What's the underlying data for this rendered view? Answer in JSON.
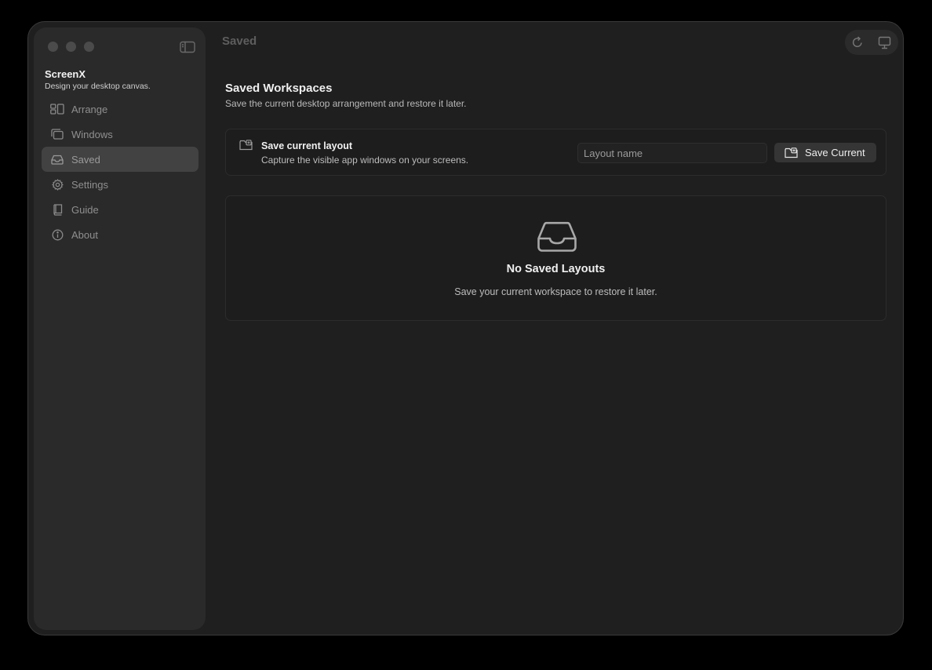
{
  "app": {
    "name": "ScreenX",
    "tagline": "Design your desktop canvas."
  },
  "sidebar": {
    "items": [
      {
        "label": "Arrange",
        "icon": "arrange-icon",
        "active": false
      },
      {
        "label": "Windows",
        "icon": "windows-icon",
        "active": false
      },
      {
        "label": "Saved",
        "icon": "saved-tray-icon",
        "active": true
      },
      {
        "label": "Settings",
        "icon": "gear-icon",
        "active": false
      },
      {
        "label": "Guide",
        "icon": "book-icon",
        "active": false
      },
      {
        "label": "About",
        "icon": "info-icon",
        "active": false
      }
    ]
  },
  "header": {
    "title": "Saved",
    "toolbar": [
      "refresh-icon",
      "display-icon"
    ]
  },
  "main": {
    "section_title": "Saved Workspaces",
    "section_subtitle": "Save the current desktop arrangement and restore it later.",
    "save_card": {
      "title": "Save current layout",
      "subtitle": "Capture the visible app windows on your screens.",
      "input_value": "",
      "input_placeholder": "Layout name",
      "button_label": "Save Current"
    },
    "empty_state": {
      "icon": "inbox-tray-icon",
      "title": "No Saved Layouts",
      "subtitle": "Save your current workspace to restore it later."
    }
  },
  "colors": {
    "window_bg": "#1f1f1f",
    "sidebar_bg": "#2a2a2a",
    "active_item_bg": "#424242",
    "button_bg": "#353535"
  }
}
